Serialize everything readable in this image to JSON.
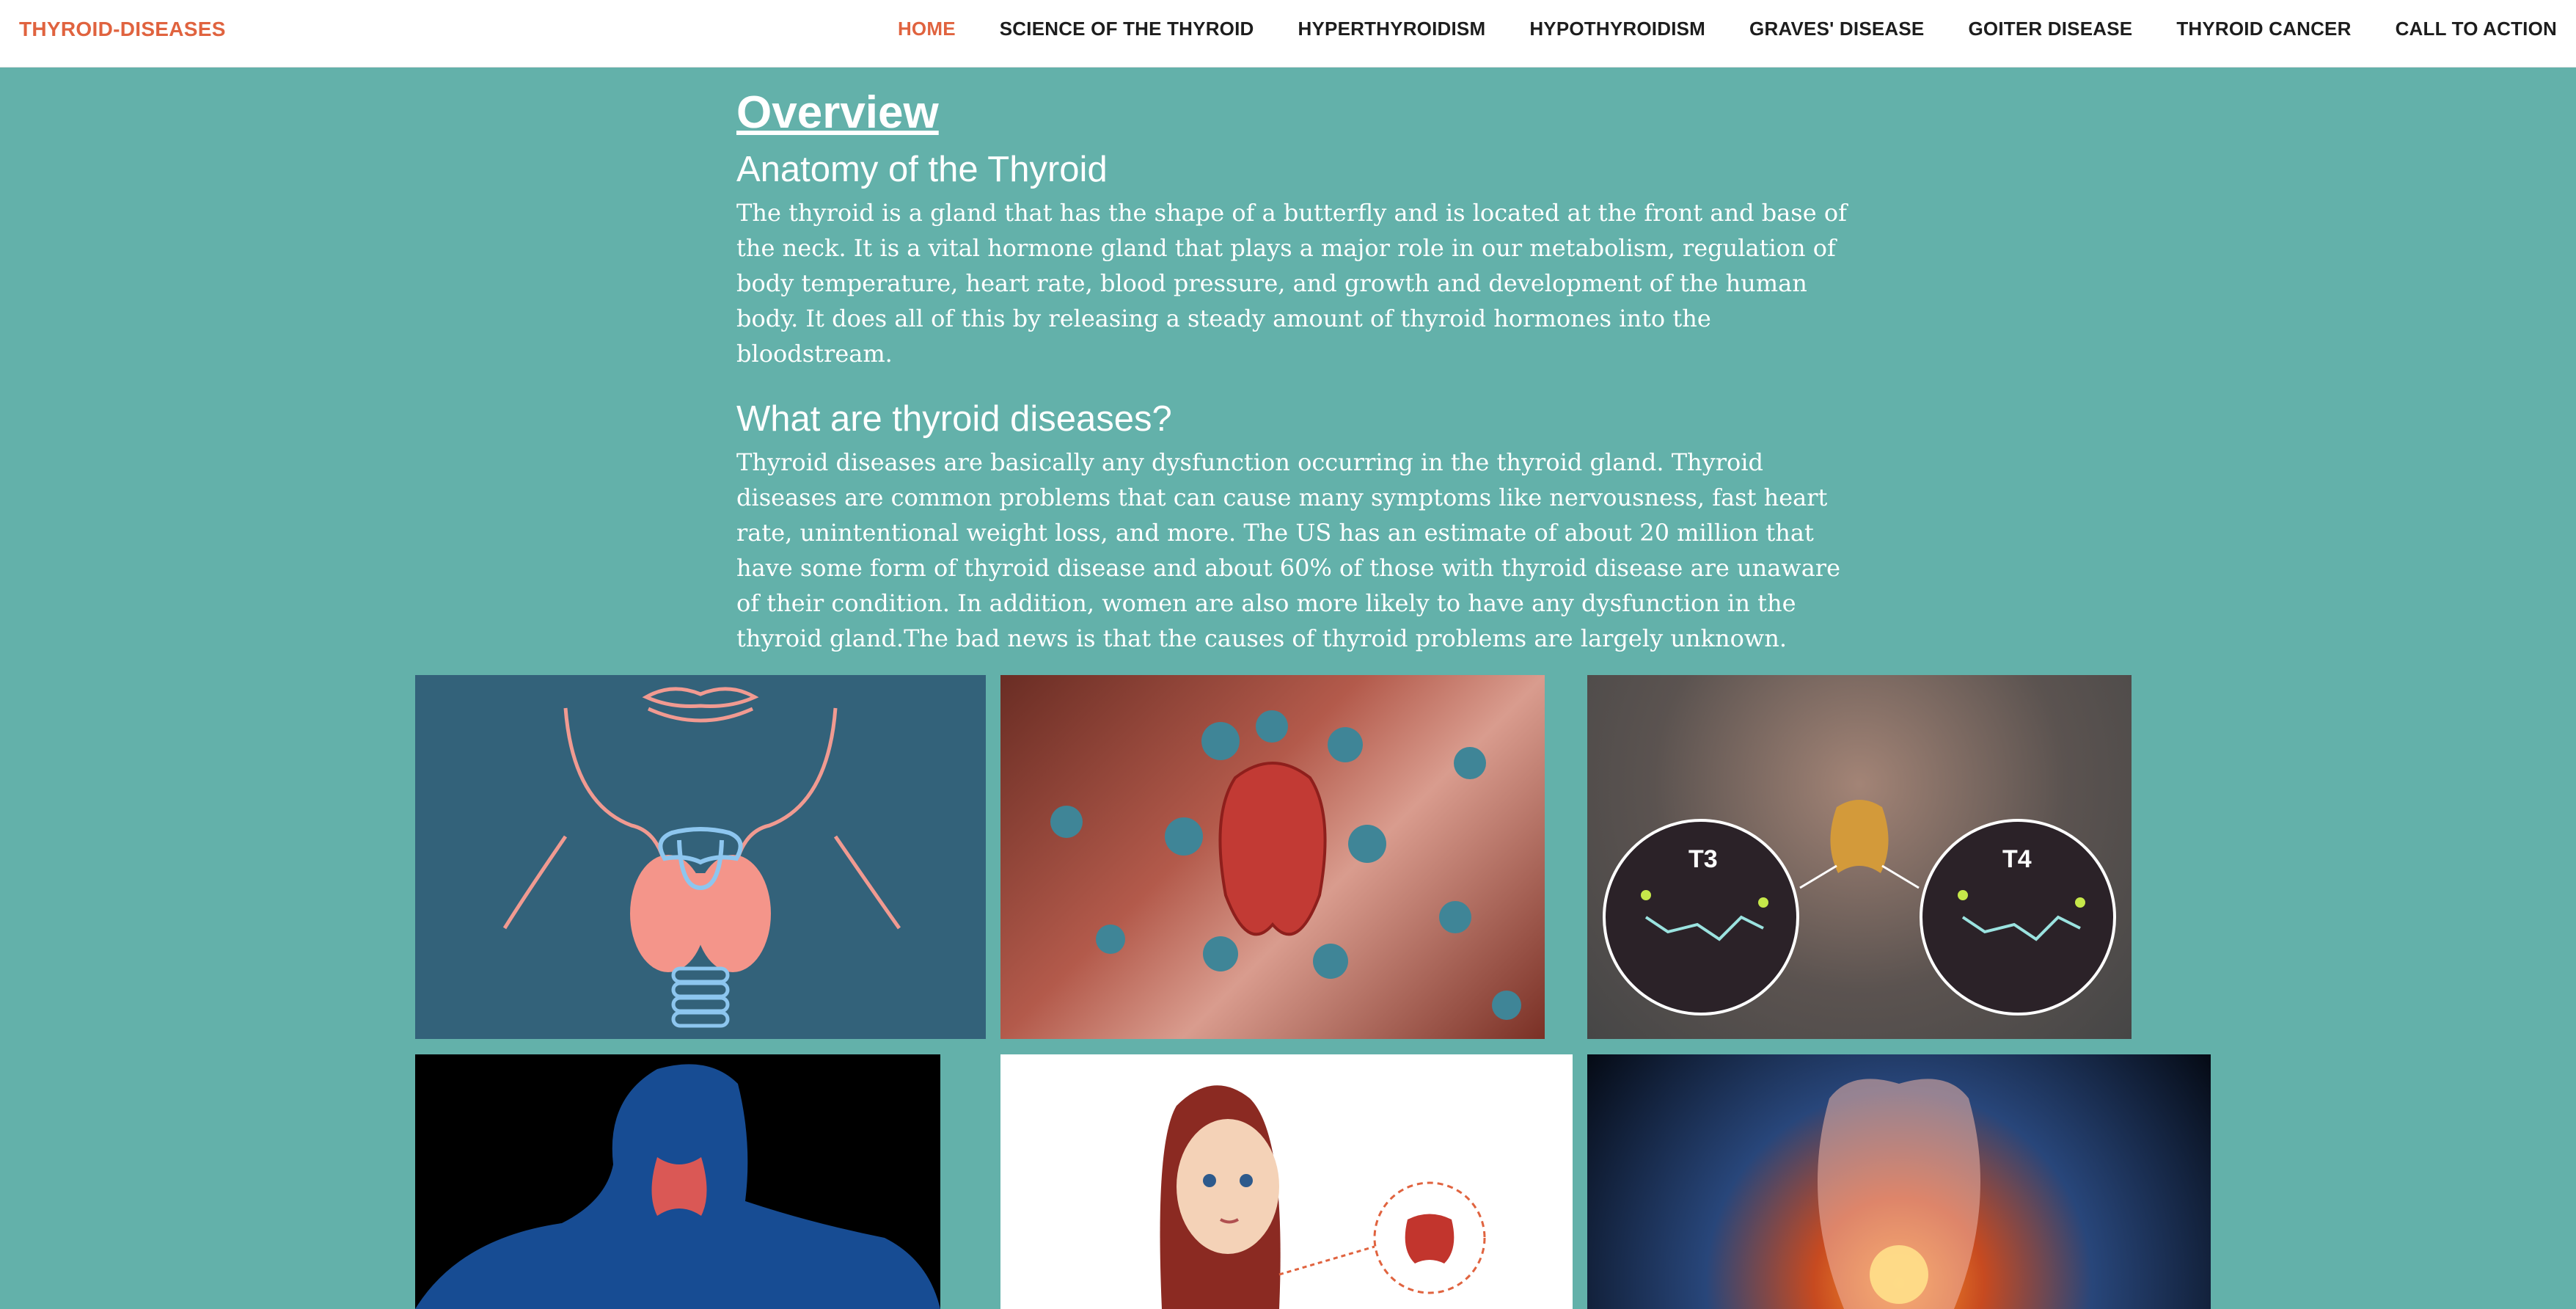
{
  "brand": "THYROID-DISEASES",
  "nav": {
    "home": "HOME",
    "science": "SCIENCE OF THE THYROID",
    "hyper": "HYPERTHYROIDISM",
    "hypo": "HYPOTHYROIDISM",
    "graves": "GRAVES' DISEASE",
    "goiter": "GOITER DISEASE",
    "cancer": "THYROID CANCER",
    "cta": "CALL TO ACTION"
  },
  "overview": {
    "title": "Overview",
    "anatomy_heading": "Anatomy of the Thyroid",
    "anatomy_text": "The thyroid is a gland that has the shape of a butterfly and is located at the front and base of the neck. It is a vital hormone gland that plays a major role in our metabolism, regulation of body temperature, heart rate, blood pressure, and growth and development of the human body. It does all of this by releasing a steady amount of thyroid hormones into the bloodstream.",
    "diseases_heading": "What are thyroid diseases?",
    "diseases_text": "Thyroid diseases are basically any dysfunction occurring in the thyroid gland. Thyroid diseases are common problems that can cause many symptoms like nervousness, fast heart rate, unintentional weight loss, and more. The US has an estimate of about 20 million that have some form of thyroid disease and about 60% of those with thyroid disease are unaware of their condition. In addition, women are also more likely to have any dysfunction in the thyroid gland.The bad news is that the causes of thyroid problems are largely unknown."
  },
  "gallery": {
    "hormone_labels": {
      "t3": "T3",
      "t4": "T4"
    }
  },
  "colors": {
    "accent": "#e0633f",
    "background": "#63b1aa"
  }
}
